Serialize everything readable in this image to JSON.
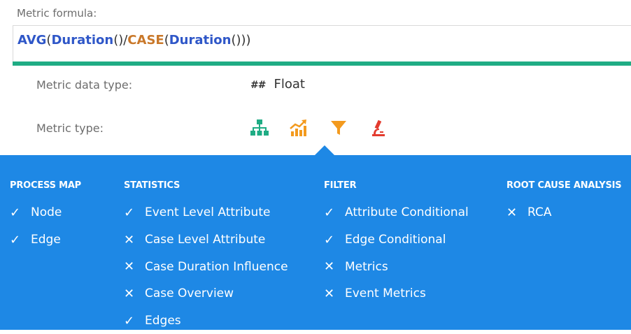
{
  "formula": {
    "label": "Metric formula:",
    "tokens": [
      {
        "text": "AVG",
        "color": "#2f57c8",
        "bold": true
      },
      {
        "text": "(",
        "color": "#333333",
        "bold": false
      },
      {
        "text": "Duration",
        "color": "#2f57c8",
        "bold": true
      },
      {
        "text": "()/",
        "color": "#333333",
        "bold": false
      },
      {
        "text": "CASE",
        "color": "#c9782a",
        "bold": true
      },
      {
        "text": "(",
        "color": "#333333",
        "bold": false
      },
      {
        "text": "Duration",
        "color": "#2f57c8",
        "bold": true
      },
      {
        "text": "()))",
        "color": "#333333",
        "bold": false
      }
    ],
    "underline_color": "#1fac84"
  },
  "data_type": {
    "label": "Metric data type:",
    "icon_text": "##",
    "value": "Float"
  },
  "metric_type": {
    "label": "Metric type:",
    "icons": [
      {
        "name": "process-map-icon",
        "color": "#1fac84"
      },
      {
        "name": "statistics-icon",
        "color": "#f39a1e"
      },
      {
        "name": "filter-icon",
        "color": "#f39a1e",
        "selected": true
      },
      {
        "name": "root-cause-analysis-icon",
        "color": "#e33b2e"
      }
    ]
  },
  "panel": {
    "background": "#1e88e5",
    "columns": [
      {
        "heading": "PROCESS MAP",
        "items": [
          {
            "label": "Node",
            "mark": "✓"
          },
          {
            "label": "Edge",
            "mark": "✓"
          }
        ]
      },
      {
        "heading": "STATISTICS",
        "items": [
          {
            "label": "Event Level Attribute",
            "mark": "✓"
          },
          {
            "label": "Case Level Attribute",
            "mark": "✕"
          },
          {
            "label": "Case Duration Influence",
            "mark": "✕"
          },
          {
            "label": "Case Overview",
            "mark": "✕"
          },
          {
            "label": "Edges",
            "mark": "✓"
          }
        ]
      },
      {
        "heading": "FILTER",
        "items": [
          {
            "label": "Attribute Conditional",
            "mark": "✓"
          },
          {
            "label": "Edge Conditional",
            "mark": "✓"
          },
          {
            "label": "Metrics",
            "mark": "✕"
          },
          {
            "label": "Event Metrics",
            "mark": "✕"
          }
        ]
      },
      {
        "heading": "ROOT CAUSE ANALYSIS",
        "items": [
          {
            "label": "RCA",
            "mark": "✕"
          }
        ]
      }
    ]
  }
}
